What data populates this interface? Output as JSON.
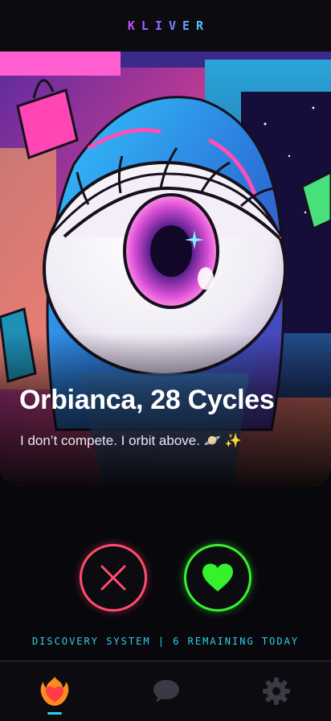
{
  "app": {
    "brand": "KLIVER"
  },
  "profile": {
    "name_age": "Orbianca, 28 Cycles",
    "bio": "I don’t compete. I orbit above. 🪐 ✨"
  },
  "actions": {
    "pass_icon": "close-icon",
    "like_icon": "heart-icon",
    "pass_color": "#ff4d6d",
    "like_color": "#35f22c"
  },
  "status": {
    "text": "DISCOVERY SYSTEM | 6 REMAINING TODAY"
  },
  "tab_bar": {
    "tabs": [
      {
        "icon": "flaming-heart-icon",
        "active": true
      },
      {
        "icon": "chat-bubble-icon",
        "active": false
      },
      {
        "icon": "gear-icon",
        "active": false
      }
    ],
    "accent": "#2ed0e6"
  }
}
